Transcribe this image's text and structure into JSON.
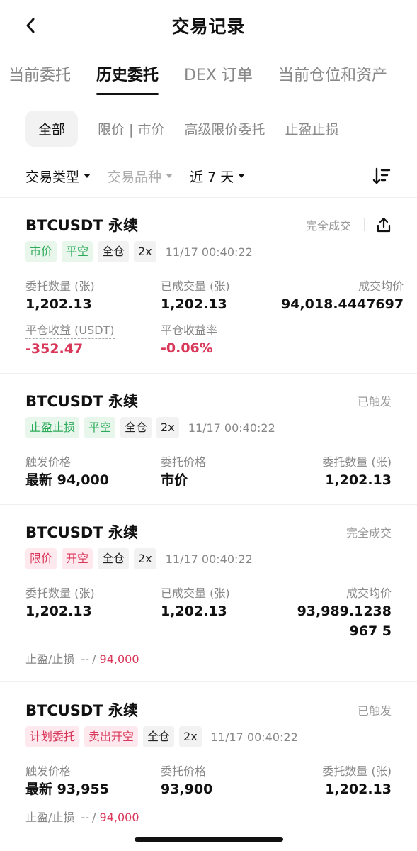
{
  "header": {
    "title": "交易记录"
  },
  "tabs": [
    "当前委托",
    "历史委托",
    "DEX 订单",
    "当前仓位和资产"
  ],
  "filters": [
    "全部",
    "限价 | 市价",
    "高级限价委托",
    "止盈止损"
  ],
  "selectors": {
    "type": "交易类型",
    "symbol": "交易品种",
    "range": "近 7 天"
  },
  "orders": [
    {
      "pair": "BTCUSDT 永续",
      "status": "完全成交",
      "tags": [
        "市价",
        "平空",
        "全仓",
        "2x"
      ],
      "time": "11/17 00:40:22",
      "fields": [
        {
          "label": "委托数量 (张)",
          "value": "1,202.13"
        },
        {
          "label": "已成交量 (张)",
          "value": "1,202.13"
        },
        {
          "label": "成交均价",
          "value": "94,018.4447697"
        },
        {
          "label": "平仓收益 (USDT)",
          "value": "-352.47"
        },
        {
          "label": "平仓收益率",
          "value": "-0.06%"
        }
      ]
    },
    {
      "pair": "BTCUSDT 永续",
      "status": "已触发",
      "tags": [
        "止盈止损",
        "平空",
        "全仓",
        "2x"
      ],
      "time": "11/17 00:40:22",
      "fields": [
        {
          "label": "触发价格",
          "value": "最新 94,000"
        },
        {
          "label": "委托价格",
          "value": "市价"
        },
        {
          "label": "委托数量 (张)",
          "value": "1,202.13"
        }
      ]
    },
    {
      "pair": "BTCUSDT 永续",
      "status": "完全成交",
      "tags": [
        "限价",
        "开空",
        "全仓",
        "2x"
      ],
      "time": "11/17 00:40:22",
      "fields": [
        {
          "label": "委托数量 (张)",
          "value": "1,202.13"
        },
        {
          "label": "已成交量 (张)",
          "value": "1,202.13"
        },
        {
          "label": "成交均价",
          "value": "93,989.1238967 5"
        }
      ],
      "tpsl": {
        "label": "止盈/止损",
        "tp": "--",
        "sl": "94,000"
      }
    },
    {
      "pair": "BTCUSDT 永续",
      "status": "已触发",
      "tags": [
        "计划委托",
        "卖出开空",
        "全仓",
        "2x"
      ],
      "time": "11/17 00:40:22",
      "fields": [
        {
          "label": "触发价格",
          "value": "最新 93,955"
        },
        {
          "label": "委托价格",
          "value": "93,900"
        },
        {
          "label": "委托数量 (张)",
          "value": "1,202.13"
        }
      ],
      "tpsl": {
        "label": "止盈/止损",
        "tp": "--",
        "sl": "94,000"
      }
    }
  ],
  "colors": {
    "profit_negative": "#d9385a",
    "tag_green": "#2eab5a",
    "tag_red": "#d9385a"
  }
}
